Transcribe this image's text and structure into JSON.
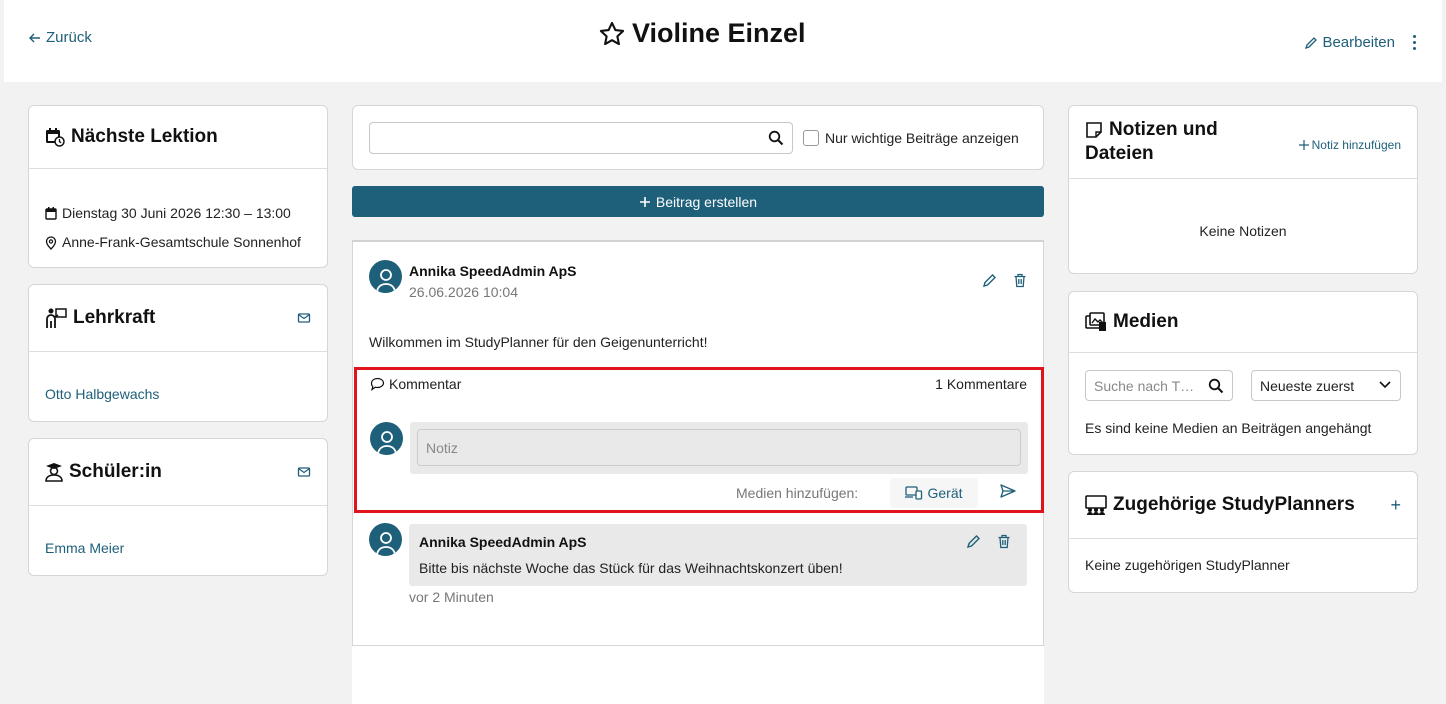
{
  "header": {
    "back_label": "Zurück",
    "title": "Violine Einzel",
    "edit_label": "Bearbeiten"
  },
  "lesson": {
    "title": "Nächste Lektion",
    "datetime": "Dienstag 30 Juni 2026 12:30 – 13:00",
    "location": "Anne-Frank-Gesamtschule Sonnenhof"
  },
  "teacher": {
    "title": "Lehrkraft",
    "name": "Otto Halbgewachs"
  },
  "student": {
    "title": "Schüler:in",
    "name": "Emma Meier"
  },
  "feed_controls": {
    "search_value": "",
    "important_only_label": "Nur wichtige Beiträge anzeigen",
    "important_only_checked": false,
    "create_label": "Beitrag erstellen"
  },
  "post": {
    "author": "Annika SpeedAdmin ApS",
    "date": "26.06.2026 10:04",
    "text": "Wilkommen im StudyPlanner für den Geigenunterricht!",
    "comment_label": "Kommentar",
    "comment_count": "1 Kommentare",
    "note_placeholder": "Notiz",
    "media_label": "Medien hinzufügen:",
    "device_label": "Gerät",
    "reply": {
      "author": "Annika SpeedAdmin ApS",
      "text": "Bitte bis nächste Woche das Stück für das Weihnachtskonzert üben!",
      "time": "vor 2 Minuten"
    }
  },
  "notes": {
    "title_line1": "Notizen und",
    "title_line2": "Dateien",
    "add_label": "Notiz hinzufügen",
    "empty": "Keine Notizen"
  },
  "media": {
    "title": "Medien",
    "search_placeholder": "Suche nach T…",
    "sort_value": "Neueste zuerst",
    "empty": "Es sind keine Medien an Beiträgen angehängt"
  },
  "related": {
    "title": "Zugehörige StudyPlanners",
    "empty": "Keine zugehörigen StudyPlanner"
  },
  "colors": {
    "accent": "#1e5f7a",
    "highlight": "#e0141c",
    "background": "#f2f2f2"
  }
}
